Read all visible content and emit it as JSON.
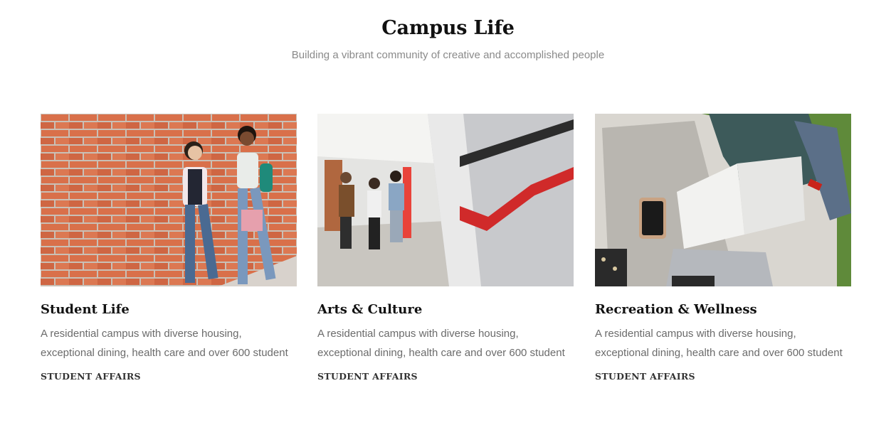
{
  "header": {
    "title": "Campus Life",
    "subtitle": "Building a vibrant community of creative and accomplished people"
  },
  "cards": [
    {
      "title": "Student Life",
      "text": "A residential campus with diverse housing, exceptional dining, health care and over 600 student",
      "link": "STUDENT AFFAIRS"
    },
    {
      "title": "Arts & Culture",
      "text": "A residential campus with diverse housing, exceptional dining, health care and over 600 student",
      "link": "STUDENT AFFAIRS"
    },
    {
      "title": "Recreation & Wellness",
      "text": "A residential campus with diverse housing, exceptional dining, health care and over 600 student",
      "link": "STUDENT AFFAIRS"
    }
  ]
}
